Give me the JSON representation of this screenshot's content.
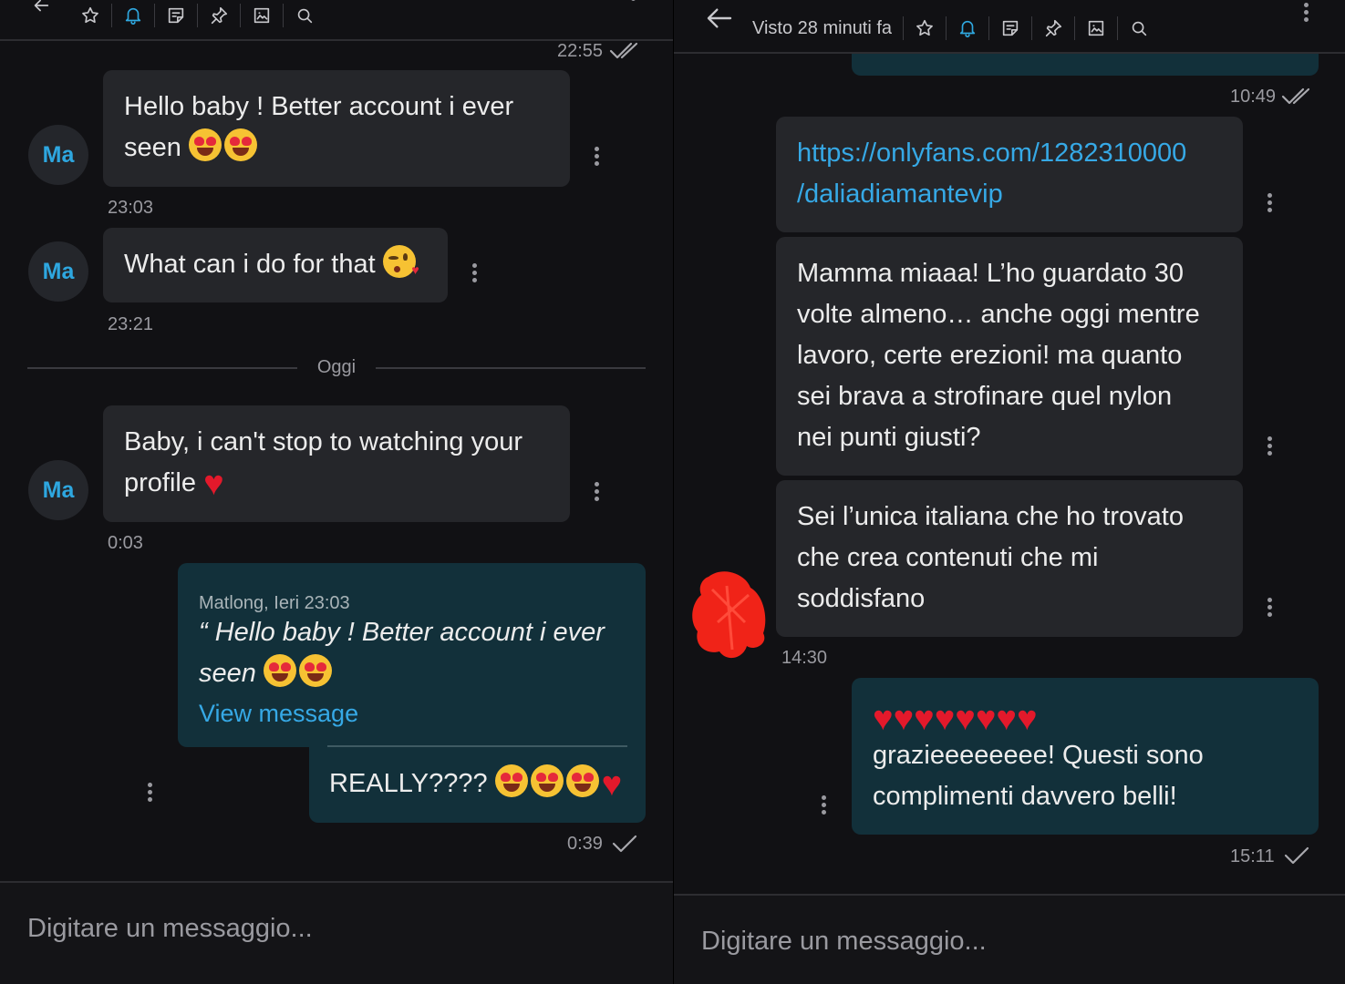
{
  "left": {
    "top_time": "22:55",
    "messages": [
      {
        "avatar": "Ma",
        "text": "Hello baby ! Better account i ever",
        "text2": "seen",
        "time": "23:03"
      },
      {
        "avatar": "Ma",
        "text": "What can i do for that",
        "time": "23:21"
      },
      {
        "avatar": "Ma",
        "text": "Baby, i can't stop to watching your",
        "text2": "profile",
        "time": "0:03"
      }
    ],
    "divider_label": "Oggi",
    "reply": {
      "quote_author": "Matlong, Ieri 23:03",
      "quote_text": "“ Hello baby ! Better account i ever",
      "quote_text2": "seen",
      "view_message": "View message",
      "text": "REALLY????",
      "time": "0:39"
    },
    "input_placeholder": "Digitare un messaggio..."
  },
  "right": {
    "status": "Visto 28 minuti fa",
    "top_time": "10:49",
    "messages": [
      {
        "text": "https://onlyfans.com/1282310000",
        "text2": "/daliadiamantevip"
      },
      {
        "lines": [
          "Mamma miaaa! L’ho guardato 30",
          "volte almeno… anche oggi mentre",
          "lavoro, certe erezioni! ma quanto",
          "sei brava a strofinare quel nylon",
          "nei punti giusti?"
        ]
      },
      {
        "lines": [
          "Sei l’unica italiana che ho trovato",
          "che crea contenuti che mi",
          "soddisfano"
        ]
      }
    ],
    "incoming_time": "14:30",
    "reply_lines": [
      "grazieeeeeeee! Questi sono",
      "complimenti davvero belli!"
    ],
    "reply_time": "15:11",
    "input_placeholder": "Digitare un messaggio..."
  },
  "icons": [
    "star-icon",
    "bell-icon",
    "note-icon",
    "pin-icon",
    "image-icon",
    "search-icon",
    "more-icon",
    "back-arrow-icon"
  ],
  "colors": {
    "accent": "#2ea7e0",
    "bg": "#111114",
    "bubble_in": "#25262a",
    "bubble_out": "#12303a",
    "heart": "#e3192b"
  }
}
